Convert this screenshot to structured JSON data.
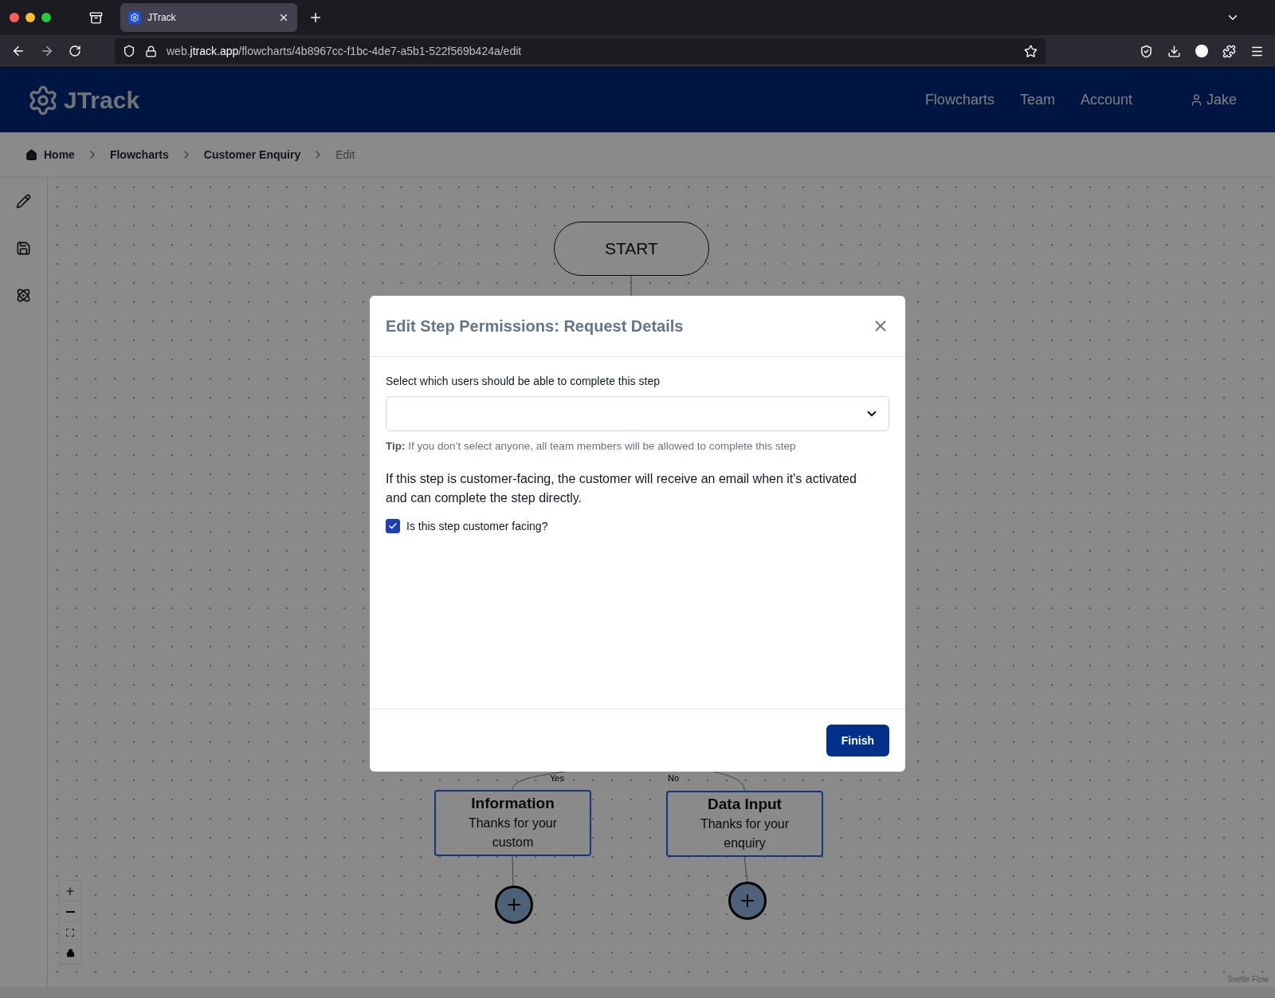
{
  "browser": {
    "tabs": [
      {
        "title": "JTrack",
        "selected": true
      }
    ],
    "url": "web.**jtrack.app**/flowcharts/4b8967cc-f1bc-4de7-a5b1-522f569b424a/edit"
  },
  "header": {
    "logo": "JTrack",
    "nav": [
      "Flowcharts",
      "Team",
      "Account"
    ],
    "user": "Jake"
  },
  "breadcrumbs": [
    {
      "label": "Home",
      "current": false
    },
    {
      "label": "Flowcharts",
      "current": false
    },
    {
      "label": "Customer Enquiry",
      "current": false
    },
    {
      "label": "Edit",
      "current": true
    }
  ],
  "canvas": {
    "nodes": [
      {
        "kind": "terminal",
        "label": "START"
      },
      {
        "kind": "step",
        "title": "Information",
        "text": "Thanks for your custom"
      },
      {
        "kind": "step",
        "title": "Data Input",
        "text": "Thanks for your enquiry"
      }
    ],
    "edge_labels": [
      "Yes",
      "No"
    ],
    "attribution": "Svelte Flow"
  },
  "modal": {
    "title": "Edit Step Permissions: Request Details",
    "field_label": "Select which users should be able to complete this step",
    "tip": "**Tip:** If you don’t select anyone, all team members will be allowed to complete this step",
    "paragraph": "If this step is customer-facing, the customer will receive an email when it's activated and can complete the step directly.",
    "checkbox": {
      "label": "Is this step customer facing?",
      "checked": true
    },
    "button": "Finish"
  }
}
